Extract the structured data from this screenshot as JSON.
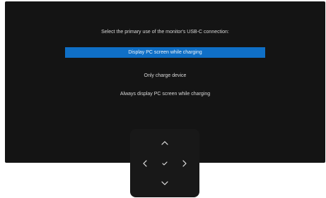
{
  "osd": {
    "prompt": "Select the primary use of the monitor's USB-C connection:",
    "options": [
      {
        "label": "Display PC screen while charging",
        "selected": true
      },
      {
        "label": "Only charge device",
        "selected": false
      },
      {
        "label": "Always display PC screen while charging",
        "selected": false
      }
    ],
    "colors": {
      "panel_background": "#141414",
      "selection_highlight": "#0f6fc6",
      "text": "#d8d8d8"
    }
  },
  "navigation_pad": {
    "buttons": [
      {
        "name": "up",
        "icon": "chevron-up-icon"
      },
      {
        "name": "left",
        "icon": "chevron-left-icon"
      },
      {
        "name": "ok",
        "icon": "checkmark-icon"
      },
      {
        "name": "right",
        "icon": "chevron-right-icon"
      },
      {
        "name": "down",
        "icon": "chevron-down-icon"
      }
    ]
  }
}
